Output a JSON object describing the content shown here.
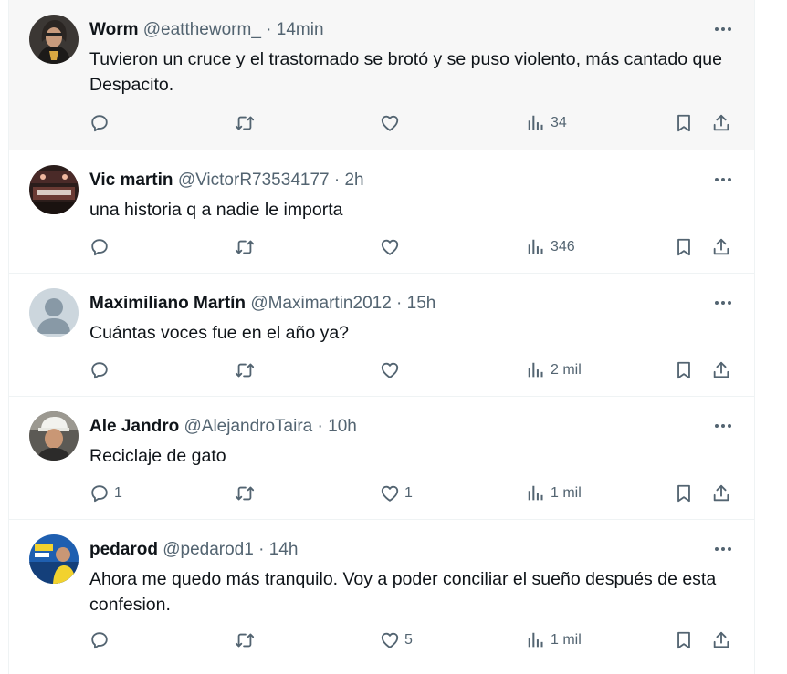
{
  "tweets": [
    {
      "name": "Worm",
      "handle": "@eattheworm_",
      "sep": " · ",
      "time": "14min",
      "text": "Tuvieron un cruce y el trastornado se brotó y se puso violento, más cantado que Despacito.",
      "replies": "",
      "likes": "",
      "views": "34"
    },
    {
      "name": "Vic martin",
      "handle": "@VictorR73534177",
      "sep": " · ",
      "time": "2h",
      "text": "una historia q a nadie le importa",
      "replies": "",
      "likes": "",
      "views": "346"
    },
    {
      "name": "Maximiliano Martín",
      "handle": "@Maximartin2012",
      "sep": " · ",
      "time": "15h",
      "text": "Cuántas voces fue en el año ya?",
      "replies": "",
      "likes": "",
      "views": "2 mil"
    },
    {
      "name": "Ale Jandro",
      "handle": "@AlejandroTaira",
      "sep": " · ",
      "time": "10h",
      "text": "Reciclaje de gato",
      "replies": "1",
      "likes": "1",
      "views": "1 mil"
    },
    {
      "name": "pedarod",
      "handle": "@pedarod1",
      "sep": " · ",
      "time": "14h",
      "text": "Ahora me quedo más tranquilo. Voy a poder conciliar el sueño después de esta confesion.",
      "replies": "",
      "likes": "5",
      "views": "1 mil"
    }
  ],
  "icons": {
    "reply": "reply-icon",
    "retweet": "retweet-icon",
    "like": "like-icon",
    "views": "views-icon",
    "bookmark": "bookmark-icon",
    "share": "share-icon",
    "more": "more-icon"
  },
  "colors": {
    "text": "#0f1419",
    "secondary": "#536471",
    "hover_background": "#f7f7f7",
    "divider": "#eff3f4"
  }
}
